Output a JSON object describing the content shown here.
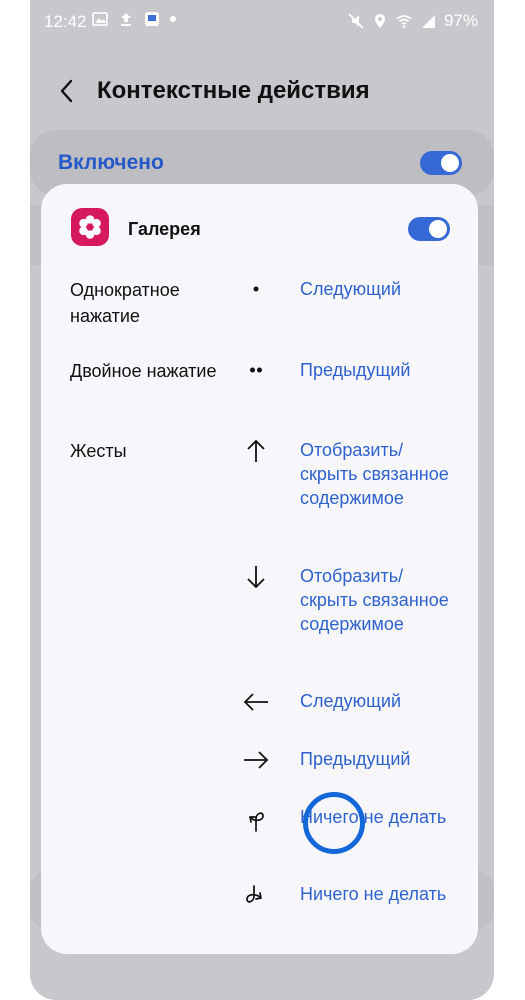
{
  "status_bar": {
    "time": "12:42",
    "battery": "97%",
    "left_icons": [
      "image-icon",
      "upload-icon",
      "cast-icon",
      "notification-dot"
    ],
    "right_icons": [
      "mute-icon",
      "location-icon",
      "wifi-icon",
      "signal-icon"
    ]
  },
  "header": {
    "title": "Контекстные действия"
  },
  "master_toggle": {
    "label": "Включено",
    "state": "on"
  },
  "app": {
    "name": "Галерея",
    "toggle_state": "on"
  },
  "rows": [
    {
      "label": "Однократное нажатие",
      "icon": "single-dot-icon",
      "value": "Следующий"
    },
    {
      "label": "Двойное нажатие",
      "icon": "double-dot-icon",
      "value": "Предыдущий"
    },
    {
      "label": "Жесты",
      "icon": "arrow-up-icon",
      "value": "Отобразить/ скрыть связанное содержимое"
    },
    {
      "label": "",
      "icon": "arrow-down-icon",
      "value": "Отобразить/ скрыть связанное содержимое"
    },
    {
      "label": "",
      "icon": "arrow-left-icon",
      "value": "Следующий"
    },
    {
      "label": "",
      "icon": "arrow-right-icon",
      "value": "Предыдущий"
    },
    {
      "label": "",
      "icon": "loop-left-gesture-icon",
      "value": "Ничего не делать"
    },
    {
      "label": "",
      "icon": "loop-right-gesture-icon",
      "value": "Ничего не делать"
    }
  ],
  "colors": {
    "accent": "#2e62cf",
    "toggle": "#3769d6",
    "app_icon": "#d6185c",
    "cursor": "#1467d8"
  }
}
